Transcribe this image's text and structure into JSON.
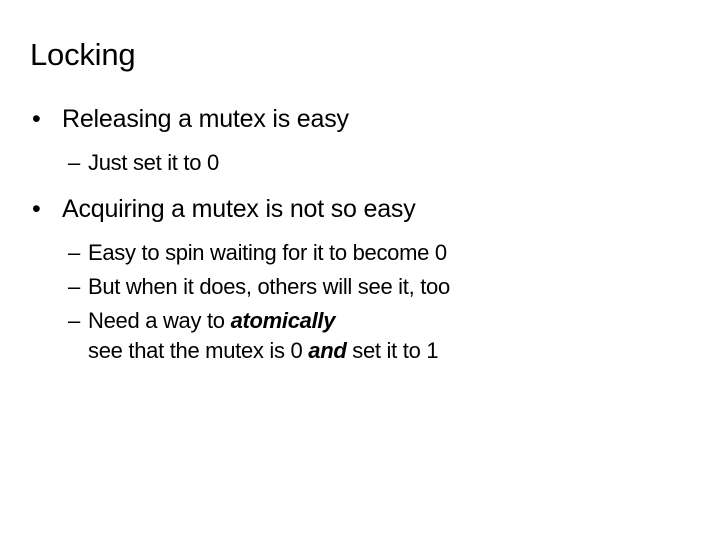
{
  "slide": {
    "title": "Locking",
    "background_color": "#ffffff",
    "text_color": "#000000",
    "bullet_marker": "•",
    "dash_marker": "–",
    "blocks": [
      {
        "level": 1,
        "text": "Releasing a mutex is easy"
      },
      {
        "level": 2,
        "text": "Just set it to 0"
      },
      {
        "level": 1,
        "text": "Acquiring a mutex is not so easy"
      },
      {
        "level": 2,
        "text": "Easy to spin waiting for it to become 0"
      },
      {
        "level": 2,
        "text": "But when it does, others will see it, too"
      },
      {
        "level": 2,
        "text_parts": {
          "lead": "Need a way to ",
          "emphasis": "atomically",
          "cont_lead": "see that the mutex is 0 ",
          "cont_emphasis": "and",
          "cont_tail": " set it to 1"
        }
      }
    ]
  }
}
